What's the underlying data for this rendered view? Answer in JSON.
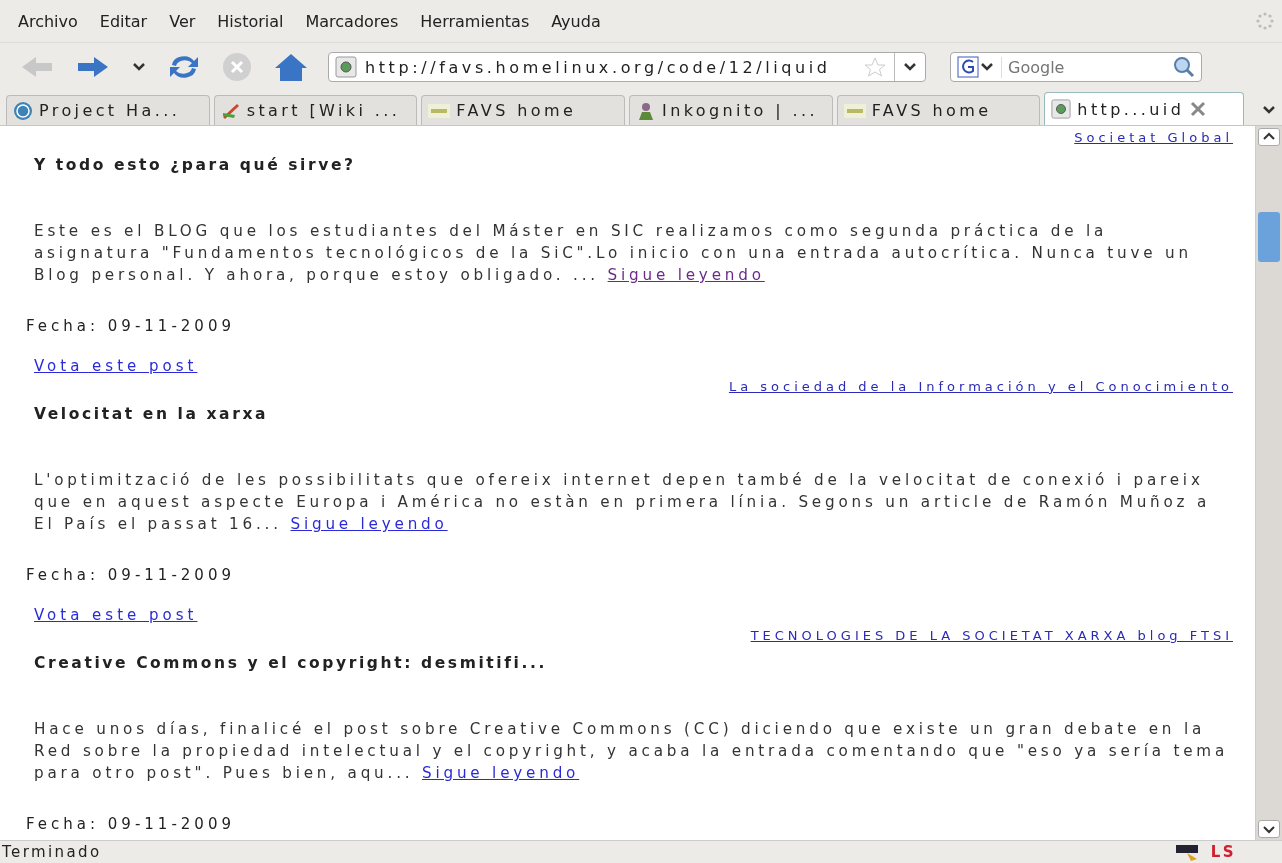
{
  "menu": [
    "Archivo",
    "Editar",
    "Ver",
    "Historial",
    "Marcadores",
    "Herramientas",
    "Ayuda"
  ],
  "toolbar": {
    "back_disabled": true,
    "stop_disabled": true,
    "url": "http://favs.homelinux.org/code/12/liquid",
    "search": {
      "placeholder": "Google"
    }
  },
  "tabs": [
    {
      "label": "Project Ha...",
      "kind": "wp",
      "selected": false
    },
    {
      "label": "start [Wiki ...",
      "kind": "wiki",
      "selected": false
    },
    {
      "label": "FAVS home",
      "kind": "favs",
      "selected": false
    },
    {
      "label": "Inkognito | ...",
      "kind": "ink",
      "selected": false
    },
    {
      "label": "FAVS home",
      "kind": "favs",
      "selected": false
    },
    {
      "label": "http...uid",
      "kind": "page",
      "selected": true
    }
  ],
  "posts": [
    {
      "source": "Societat Global",
      "title": "Y todo esto ¿para qué sirve?",
      "excerpt": "Este es el BLOG que los estudiantes del Máster en SIC realizamos como segunda práctica de la asignatura \"Fundamentos tecnológicos de la SiC\".Lo inicio con una entrada autocrítica. Nunca tuve un Blog personal. Y ahora, porque estoy obligado. ...",
      "more": {
        "label": "Sigue leyendo",
        "visited": true
      },
      "date": "Fecha: 09-11-2009",
      "vote": "Vota este post"
    },
    {
      "source": "La sociedad de la Información y el Conocimiento",
      "title": "Velocitat en la xarxa",
      "excerpt": "L'optimització de les possibilitats que ofereix internet depen també de la velocitat de conexió i pareix que en aquest aspecte Europa i América no estàn en primera línia. Segons un article de Ramón Muñoz a El País el passat 16...",
      "more": {
        "label": "Sigue leyendo",
        "visited": false
      },
      "date": "Fecha: 09-11-2009",
      "vote": "Vota este post"
    },
    {
      "source": "TECNOLOGIES DE LA SOCIETAT XARXA blog FTSI",
      "title": "Creative Commons y el copyright: desmitifi...",
      "excerpt": "Hace unos días, finalicé el post sobre Creative Commons (CC) diciendo que existe un gran debate en la Red sobre la propiedad intelectual y el copyright, y acaba la entrada comentando que \"eso ya sería tema para otro post\". Pues bien, aqu...",
      "more": {
        "label": "Sigue leyendo",
        "visited": false
      },
      "date": "Fecha: 09-11-2009"
    }
  ],
  "status_bar": {
    "text": "Terminado",
    "indicator": "LS"
  }
}
